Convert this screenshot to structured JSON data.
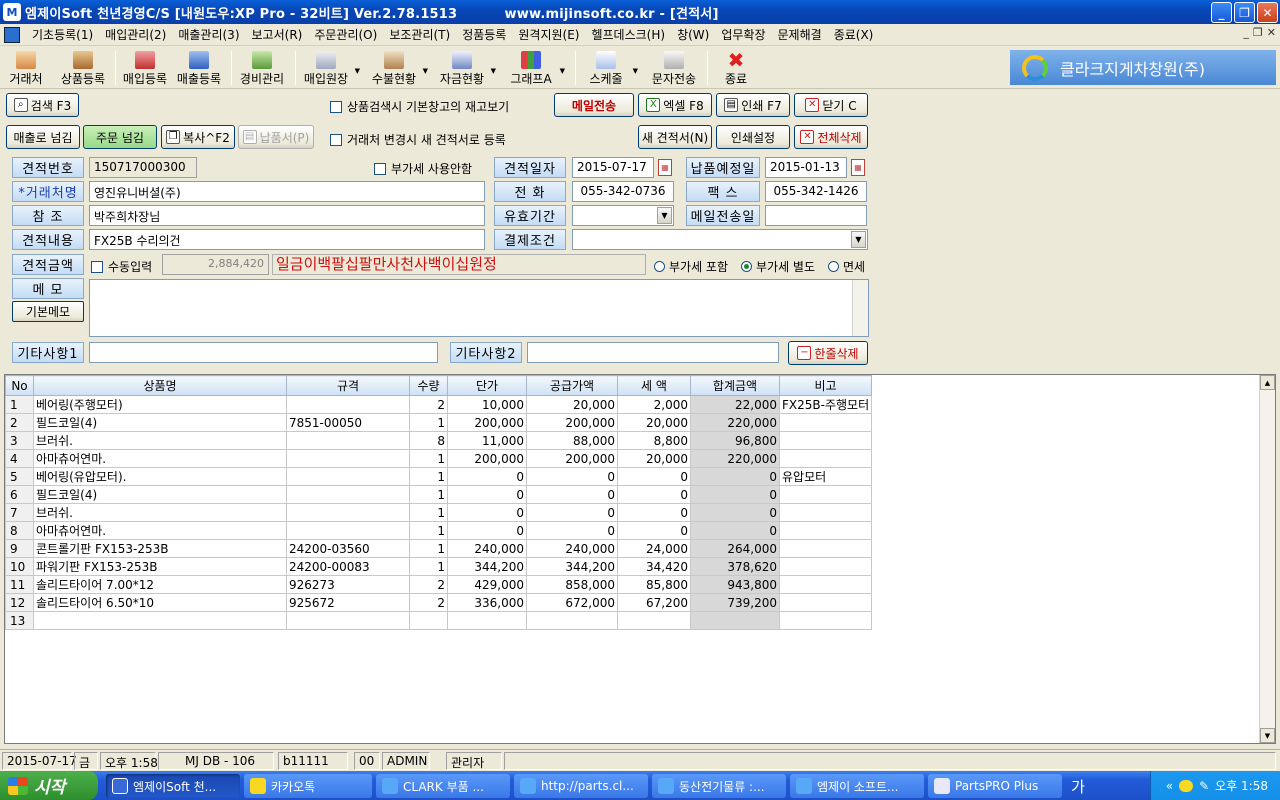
{
  "window": {
    "title": "엠제이Soft 천년경영C/S [내원도우:XP Pro - 32비트] Ver.2.78.1513          www.mijinsoft.co.kr - [견적서]"
  },
  "menu": [
    "기초등록(1)",
    "매입관리(2)",
    "매출관리(3)",
    "보고서(R)",
    "주문관리(O)",
    "보조관리(T)",
    "정품등록",
    "원격지원(E)",
    "헬프데스크(H)",
    "창(W)",
    "업무확장",
    "문제해결",
    "종료(X)"
  ],
  "toolbar": {
    "items": [
      "거래처",
      "상품등록",
      "매입등록",
      "매출등록",
      "경비관리",
      "매입원장",
      "수불현황",
      "자금현황",
      "그래프A",
      "스케줄",
      "문자전송",
      "종료"
    ],
    "company": "클라크지게차창원(주)"
  },
  "actions": {
    "search": "검색 F3",
    "stock_check": "상품검색시 기본창고의 재고보기",
    "email": "메일전송",
    "excel": "엑셀 F8",
    "print": "인쇄 F7",
    "close": "닫기 C",
    "to_sales": "매출로 넘김",
    "to_order": "주문 넘김",
    "copy": "복사^F2",
    "delivery": "납품서(P)",
    "new_on_change": "거래처 변경시 새 견적서로 등록",
    "new_quote": "새 견적서(N)",
    "print_settings": "인쇄설정",
    "delete_all": "전체삭제",
    "delete_row": "한줄삭제"
  },
  "form": {
    "quote_no_label": "견적번호",
    "quote_no": "150717000300",
    "no_vat": "부가세 사용안함",
    "quote_date_label": "견적일자",
    "quote_date": "2015-07-17",
    "delivery_date_label": "납품예정일",
    "delivery_date": "2015-01-13",
    "customer_label": "*거래처명",
    "customer": "영진유니버셜(주)",
    "phone_label": "전      화",
    "phone": "055-342-0736",
    "fax_label": "팩      스",
    "fax": "055-342-1426",
    "ref_label": "참   조",
    "ref": "박주희차장님",
    "valid_label": "유효기간",
    "valid": "",
    "mail_date_label": "메일전송일",
    "mail_date": "",
    "content_label": "견적내용",
    "content": "FX25B 수리의건",
    "payment_label": "결제조건",
    "payment": "",
    "amount_label": "견적금액",
    "manual_input": "수동입력",
    "amount": "2,884,420",
    "amount_korean": "일금이백팔십팔만사천사백이십원정",
    "vat_options": [
      "부가세 포함",
      "부가세 별도",
      "면세"
    ],
    "vat_selected": "부가세 별도",
    "memo_label": "메   모",
    "default_memo": "기본메모",
    "etc1_label": "기타사항1",
    "etc1": "",
    "etc2_label": "기타사항2",
    "etc2": ""
  },
  "grid": {
    "columns": [
      "No",
      "상품명",
      "규격",
      "수량",
      "단가",
      "공급가액",
      "세 액",
      "합계금액",
      "비고"
    ],
    "rows": [
      [
        "1",
        "베어링(주행모터)",
        "",
        "2",
        "10,000",
        "20,000",
        "2,000",
        "22,000",
        "FX25B-주행모터"
      ],
      [
        "2",
        "필드코일(4)",
        "7851-00050",
        "1",
        "200,000",
        "200,000",
        "20,000",
        "220,000",
        ""
      ],
      [
        "3",
        "브러쉬.",
        "",
        "8",
        "11,000",
        "88,000",
        "8,800",
        "96,800",
        ""
      ],
      [
        "4",
        "아마츄어연마.",
        "",
        "1",
        "200,000",
        "200,000",
        "20,000",
        "220,000",
        ""
      ],
      [
        "5",
        "베어링(유압모터).",
        "",
        "1",
        "0",
        "0",
        "0",
        "0",
        "유압모터"
      ],
      [
        "6",
        "필드코일(4)",
        "",
        "1",
        "0",
        "0",
        "0",
        "0",
        ""
      ],
      [
        "7",
        "브러쉬.",
        "",
        "1",
        "0",
        "0",
        "0",
        "0",
        ""
      ],
      [
        "8",
        "아마츄어연마.",
        "",
        "1",
        "0",
        "0",
        "0",
        "0",
        ""
      ],
      [
        "9",
        "콘트롤기판 FX153-253B",
        "24200-03560",
        "1",
        "240,000",
        "240,000",
        "24,000",
        "264,000",
        ""
      ],
      [
        "10",
        "파워기판 FX153-253B",
        "24200-00083",
        "1",
        "344,200",
        "344,200",
        "34,420",
        "378,620",
        ""
      ],
      [
        "11",
        "솔리드타이어 7.00*12",
        "926273",
        "2",
        "429,000",
        "858,000",
        "85,800",
        "943,800",
        ""
      ],
      [
        "12",
        "솔리드타이어 6.50*10",
        "925672",
        "2",
        "336,000",
        "672,000",
        "67,200",
        "739,200",
        ""
      ],
      [
        "13",
        "",
        "",
        "",
        "",
        "",
        "",
        "",
        ""
      ]
    ]
  },
  "status": {
    "date": "2015-07-17",
    "day": "금",
    "time": "오후 1:58",
    "db": "MJ DB - 106",
    "code": "b11111",
    "num": "00",
    "user": "ADMIN",
    "role": "관리자"
  },
  "taskbar": {
    "start": "시작",
    "tasks": [
      "엠제이Soft 천...",
      "카카오톡",
      "CLARK 부품 ...",
      "http://parts.cl...",
      "동산전기물류 :...",
      "엠제이 소프트...",
      "PartsPRO Plus"
    ],
    "ime": "가",
    "clock": "오후 1:58"
  }
}
